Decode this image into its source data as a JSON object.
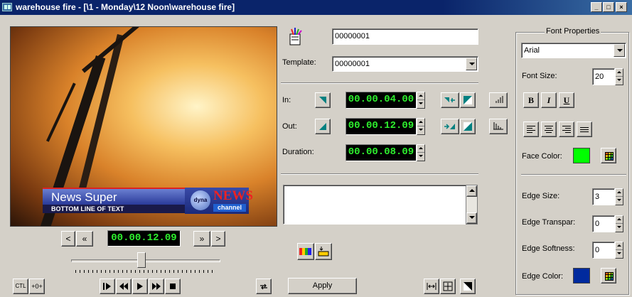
{
  "window": {
    "title": "warehouse fire - [\\1 - Monday\\12 Noon\\warehouse fire]"
  },
  "caption_buttons": [
    "minimize",
    "maximize",
    "close"
  ],
  "video": {
    "lower_third_main": "News Super",
    "lower_third_sub": "BOTTOM LINE OF TEXT",
    "logo_globe": "dyna",
    "logo_news": "NEWS",
    "logo_channel": "channel"
  },
  "transport": {
    "prev_label": "<",
    "rewind_label": "«",
    "timecode": "00.00.12.09",
    "forward_label": "»",
    "next_label": ">",
    "slider_position": 0.47
  },
  "bottom_bar": {
    "ctl_label": "CTL",
    "step_label": "+0+",
    "apply_label": "Apply"
  },
  "clip": {
    "name_value": "00000001",
    "template_label": "Template:",
    "template_value": "00000001",
    "in_label": "In:",
    "in_value": "00.00.04.00",
    "out_label": "Out:",
    "out_value": "00.00.12.09",
    "duration_label": "Duration:",
    "duration_value": "00.00.08.09",
    "notes_value": ""
  },
  "font_panel": {
    "title": "Font Properties",
    "font_name": "Arial",
    "font_size_label": "Font Size:",
    "font_size_value": "20",
    "bold_label": "B",
    "italic_label": "I",
    "underline_label": "U",
    "face_color_label": "Face Color:",
    "face_color": "#00ff00",
    "edge_size_label": "Edge Size:",
    "edge_size_value": "3",
    "edge_transpar_label": "Edge Transpar:",
    "edge_transpar_value": "0",
    "edge_softness_label": "Edge Softness:",
    "edge_softness_value": "0",
    "edge_color_label": "Edge Color:",
    "edge_color": "#002a9e"
  },
  "colors": {
    "titlebar": "#0a246a",
    "lcd_text": "#2ef02e",
    "teal_icon": "#008080"
  }
}
